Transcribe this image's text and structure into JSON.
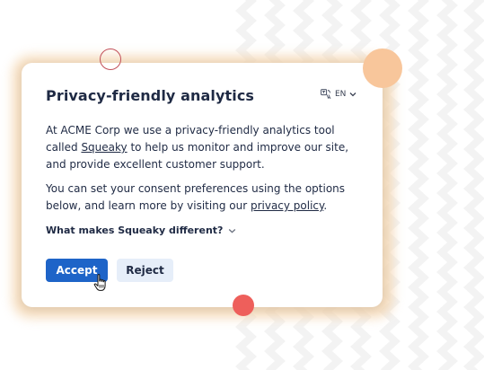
{
  "dialog": {
    "title": "Privacy-friendly analytics",
    "language": {
      "code": "EN",
      "icon": "translate-icon",
      "chevron_icon": "chevron-down-icon"
    },
    "paragraph1": {
      "before": "At ACME Corp we use a privacy-friendly analytics tool called ",
      "link": "Squeaky",
      "after": " to help us monitor and improve our site, and provide excellent customer support."
    },
    "paragraph2": {
      "before": "You can set your consent preferences using the options below, and learn more by visiting our ",
      "link": "privacy policy",
      "after": "."
    },
    "disclosure": {
      "label": "What makes Squeaky different?",
      "icon": "chevron-down-icon"
    },
    "buttons": {
      "accept": "Accept",
      "reject": "Reject"
    }
  },
  "colors": {
    "accent": "#1e64c8",
    "secondary_button": "#e6eef9",
    "text": "#1f2a44",
    "glow": "#f4d7b3",
    "peach_dot": "#f8c69b",
    "red_dot": "#ee5f5b",
    "ring": "#c2505a"
  },
  "decorations": {
    "cursor_icon": "hand-pointer-icon"
  }
}
